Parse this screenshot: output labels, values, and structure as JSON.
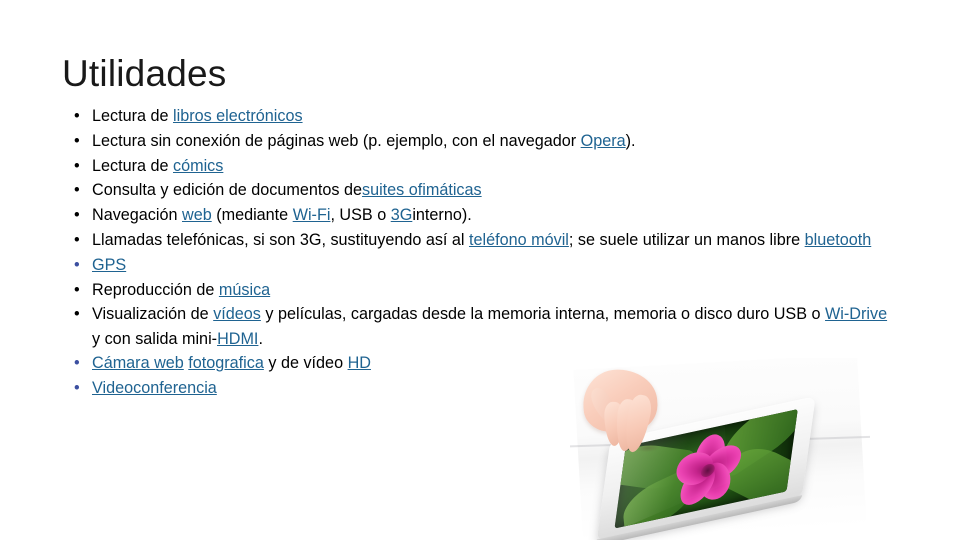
{
  "slide": {
    "title": "Utilidades",
    "background_color": "#ffffff",
    "link_color": "#1f6391",
    "text_color": "#000000",
    "bullets": [
      {
        "id": "lectura-libros",
        "marker": "•",
        "marker_is_link": false,
        "parts": [
          {
            "text": "Lectura de ",
            "link": false
          },
          {
            "text": "libros electrónicos",
            "link": true
          }
        ]
      },
      {
        "id": "lectura-sin-conexion",
        "marker": "•",
        "marker_is_link": false,
        "parts": [
          {
            "text": "Lectura sin conexión de páginas web (p. ejemplo, con el navegador ",
            "link": false
          },
          {
            "text": "Opera",
            "link": true
          },
          {
            "text": ").",
            "link": false
          }
        ]
      },
      {
        "id": "lectura-comics",
        "marker": "•",
        "marker_is_link": false,
        "parts": [
          {
            "text": "Lectura de ",
            "link": false
          },
          {
            "text": "cómics",
            "link": true
          }
        ]
      },
      {
        "id": "consulta-edicion-documentos",
        "marker": "•",
        "marker_is_link": false,
        "parts": [
          {
            "text": "Consulta y edición de documentos de",
            "link": false
          },
          {
            "text": "suites ofimáticas",
            "link": true
          }
        ]
      },
      {
        "id": "navegacion-web",
        "marker": "•",
        "marker_is_link": false,
        "parts": [
          {
            "text": "Navegación ",
            "link": false
          },
          {
            "text": "web",
            "link": true
          },
          {
            "text": " (mediante ",
            "link": false
          },
          {
            "text": "Wi-Fi",
            "link": true
          },
          {
            "text": ", USB o ",
            "link": false
          },
          {
            "text": "3G",
            "link": true
          },
          {
            "text": "interno).",
            "link": false
          }
        ]
      },
      {
        "id": "llamadas-telefonicas",
        "marker": "•",
        "marker_is_link": false,
        "parts": [
          {
            "text": "Llamadas telefónicas, si son 3G, sustituyendo así al ",
            "link": false
          },
          {
            "text": "teléfono móvil",
            "link": true
          },
          {
            "text": "; se suele utilizar un manos libre ",
            "link": false
          },
          {
            "text": "bluetooth",
            "link": true
          }
        ]
      },
      {
        "id": "gps",
        "marker": "•",
        "marker_is_link": true,
        "parts": [
          {
            "text": "GPS",
            "link": true
          }
        ]
      },
      {
        "id": "reproduccion-musica",
        "marker": "•",
        "marker_is_link": false,
        "parts": [
          {
            "text": "Reproducción de ",
            "link": false
          },
          {
            "text": "música",
            "link": true
          }
        ]
      },
      {
        "id": "visualizacion-videos",
        "marker": "•",
        "marker_is_link": false,
        "parts": [
          {
            "text": "Visualización de ",
            "link": false
          },
          {
            "text": "vídeos",
            "link": true
          },
          {
            "text": " y películas, cargadas desde la memoria interna, memoria o disco duro USB o ",
            "link": false
          },
          {
            "text": "Wi-Drive",
            "link": true
          },
          {
            "text": " y con salida mini-",
            "link": false
          },
          {
            "text": "HDMI",
            "link": true
          },
          {
            "text": ".",
            "link": false
          }
        ]
      },
      {
        "id": "camara-web",
        "marker": "•",
        "marker_is_link": true,
        "parts": [
          {
            "text": "Cámara web",
            "link": true
          },
          {
            "text": " ",
            "link": false
          },
          {
            "text": "fotografica",
            "link": true
          },
          {
            "text": " y de vídeo ",
            "link": false
          },
          {
            "text": "HD",
            "link": true
          }
        ]
      },
      {
        "id": "videoconferencia",
        "marker": "•",
        "marker_is_link": true,
        "parts": [
          {
            "text": "Videoconferencia",
            "link": true
          }
        ]
      }
    ],
    "photo": {
      "name": "tablet-photo",
      "description": "Hand touching a white tablet showing a pink hibiscus flower on green leaves"
    }
  }
}
